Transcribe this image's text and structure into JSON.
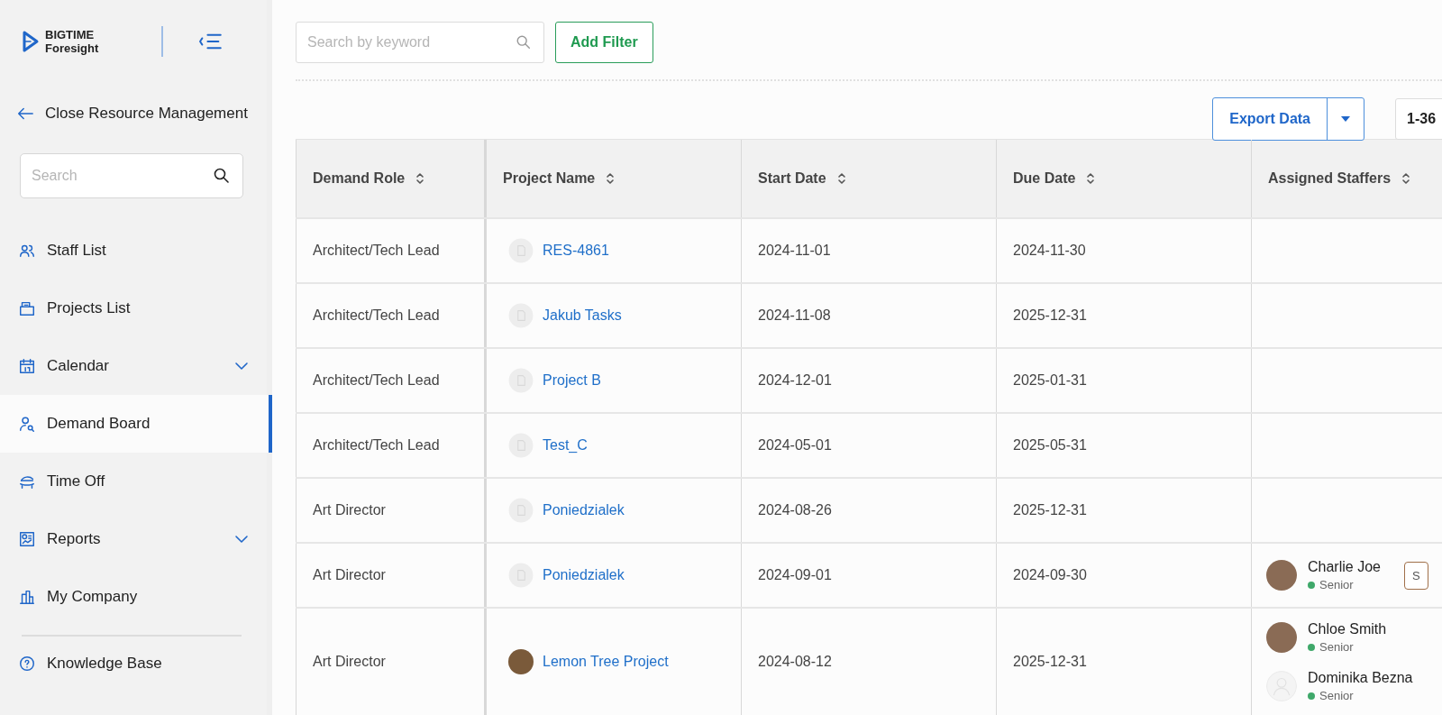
{
  "sidebar": {
    "logo": {
      "line1": "BIGTIME",
      "line2": "Foresight"
    },
    "back_link": "Close Resource Management",
    "search": {
      "placeholder": "Search"
    },
    "items": [
      {
        "label": "Staff List",
        "selected": false,
        "expandable": false
      },
      {
        "label": "Projects List",
        "selected": false,
        "expandable": false
      },
      {
        "label": "Calendar",
        "selected": false,
        "expandable": true
      },
      {
        "label": "Demand Board",
        "selected": true,
        "expandable": false
      },
      {
        "label": "Time Off",
        "selected": false,
        "expandable": false
      },
      {
        "label": "Reports",
        "selected": false,
        "expandable": true
      },
      {
        "label": "My Company",
        "selected": false,
        "expandable": false
      }
    ],
    "footer_link": "Knowledge Base"
  },
  "toolbar": {
    "search": {
      "placeholder": "Search by keyword"
    },
    "add_filter": "Add Filter",
    "export": "Export Data",
    "pager": "1-36"
  },
  "table": {
    "columns": [
      "Demand Role",
      "Project Name",
      "Start Date",
      "Due Date",
      "Assigned Staffers"
    ],
    "rows": [
      {
        "role": "Architect/Tech Lead",
        "project": {
          "name": "RES-4861",
          "kind": "placeholder"
        },
        "start": "2024-11-01",
        "due": "2024-11-30",
        "staffers": []
      },
      {
        "role": "Architect/Tech Lead",
        "project": {
          "name": "Jakub Tasks",
          "kind": "placeholder"
        },
        "start": "2024-11-08",
        "due": "2025-12-31",
        "staffers": []
      },
      {
        "role": "Architect/Tech Lead",
        "project": {
          "name": "Project B",
          "kind": "placeholder"
        },
        "start": "2024-12-01",
        "due": "2025-01-31",
        "staffers": []
      },
      {
        "role": "Architect/Tech Lead",
        "project": {
          "name": "Test_C",
          "kind": "placeholder"
        },
        "start": "2024-05-01",
        "due": "2025-05-31",
        "staffers": []
      },
      {
        "role": "Art Director",
        "project": {
          "name": "Poniedzialek",
          "kind": "placeholder"
        },
        "start": "2024-08-26",
        "due": "2025-12-31",
        "staffers": []
      },
      {
        "role": "Art Director",
        "project": {
          "name": "Poniedzialek",
          "kind": "placeholder"
        },
        "start": "2024-09-01",
        "due": "2024-09-30",
        "staffers": [
          {
            "name": "Charlie Joe",
            "level": "Senior",
            "kind": "photo",
            "tag": "S"
          }
        ]
      },
      {
        "role": "Art Director",
        "project": {
          "name": "Lemon Tree Project",
          "kind": "photo"
        },
        "start": "2024-08-12",
        "due": "2025-12-31",
        "staffers": [
          {
            "name": "Chloe Smith",
            "level": "Senior",
            "kind": "photo"
          },
          {
            "name": "Dominika Bezna",
            "level": "Senior",
            "kind": "placeholder"
          }
        ]
      }
    ]
  }
}
